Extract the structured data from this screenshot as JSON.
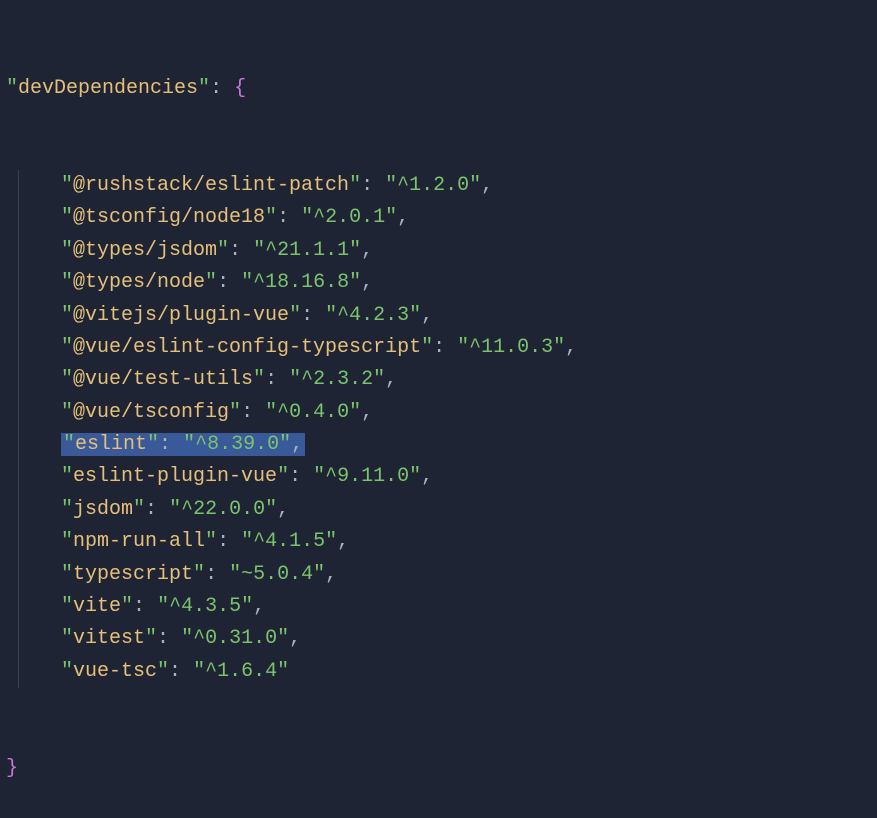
{
  "section": "devDependencies",
  "dependencies": [
    {
      "name": "@rushstack/eslint-patch",
      "version": "^1.2.0",
      "highlighted": false
    },
    {
      "name": "@tsconfig/node18",
      "version": "^2.0.1",
      "highlighted": false
    },
    {
      "name": "@types/jsdom",
      "version": "^21.1.1",
      "highlighted": false
    },
    {
      "name": "@types/node",
      "version": "^18.16.8",
      "highlighted": false
    },
    {
      "name": "@vitejs/plugin-vue",
      "version": "^4.2.3",
      "highlighted": false
    },
    {
      "name": "@vue/eslint-config-typescript",
      "version": "^11.0.3",
      "highlighted": false
    },
    {
      "name": "@vue/test-utils",
      "version": "^2.3.2",
      "highlighted": false
    },
    {
      "name": "@vue/tsconfig",
      "version": "^0.4.0",
      "highlighted": false
    },
    {
      "name": "eslint",
      "version": "^8.39.0",
      "highlighted": true
    },
    {
      "name": "eslint-plugin-vue",
      "version": "^9.11.0",
      "highlighted": false
    },
    {
      "name": "jsdom",
      "version": "^22.0.0",
      "highlighted": false
    },
    {
      "name": "npm-run-all",
      "version": "^4.1.5",
      "highlighted": false
    },
    {
      "name": "typescript",
      "version": "~5.0.4",
      "highlighted": false
    },
    {
      "name": "vite",
      "version": "^4.3.5",
      "highlighted": false
    },
    {
      "name": "vitest",
      "version": "^0.31.0",
      "highlighted": false
    },
    {
      "name": "vue-tsc",
      "version": "^1.6.4",
      "highlighted": false
    }
  ]
}
